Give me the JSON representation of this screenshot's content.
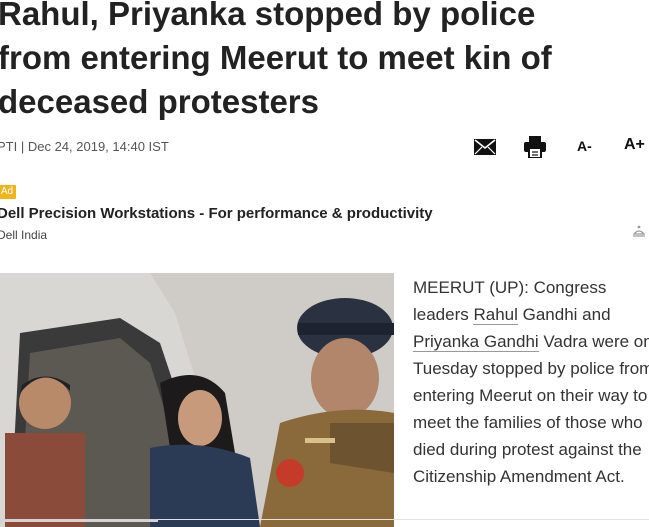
{
  "article": {
    "headline_lines": [
      "Rahul, Priyanka stopped by police",
      "from entering Meerut to meet kin of",
      "deceased protesters"
    ],
    "source": "PTI",
    "separator": " | ",
    "date": "Dec 24, 2019, 14:40 IST"
  },
  "toolbar": {
    "email_icon": "envelope-icon",
    "print_icon": "printer-icon",
    "font_decrease_label": "A-",
    "font_increase_label": "A+"
  },
  "ad": {
    "badge": "Ad",
    "title": "Dell Precision Workstations - For performance & productivity",
    "advertiser": "Dell India",
    "choices_icon": "adchoices-icon",
    "badge_color": "#f1b51c"
  },
  "photo": {
    "alt": "Priyanka Gandhi in car talking to police officer"
  },
  "body": {
    "part1": "MEERUT (UP): Congress leaders ",
    "link1": "Rahul",
    "part2": " Gandhi and ",
    "link2": "Priyanka Gandhi",
    "part3": " Vadra were on Tuesday stopped by police from entering Meerut on their way to meet the families of those who died during protest against the Citizenship Amendment Act."
  }
}
